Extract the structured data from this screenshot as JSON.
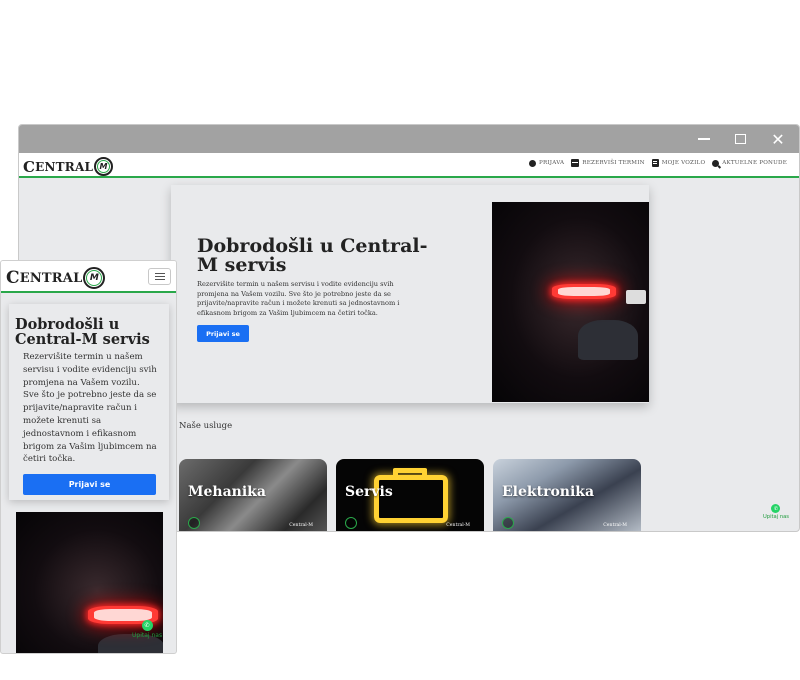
{
  "window": {
    "controls": {
      "minimize": "—",
      "maximize": "□",
      "close": "✕"
    }
  },
  "brand": {
    "logo_first": "C",
    "logo_rest": "ENTRAL",
    "logo_badge": "M"
  },
  "nav": {
    "items": [
      {
        "label": "PRIJAVA",
        "icon": "login-icon"
      },
      {
        "label": "REZERVIŠI TERMIN",
        "icon": "calendar-icon"
      },
      {
        "label": "MOJE VOZILO",
        "icon": "document-icon"
      },
      {
        "label": "AKTUELNE PONUDE",
        "icon": "search-icon"
      }
    ]
  },
  "hero": {
    "title": "Dobrodošli u Central-M servis",
    "description": "Rezervišite termin u našem servisu i vodite evidenciju svih promjena na Vašem vozilu. Sve što je potrebno jeste da se prijavite/napravite račun i možete krenuti sa jednostavnom i efikasnom brigom za Vašim ljubimcem na četiri točka.",
    "button": "Prijavi se"
  },
  "services": {
    "title": "Naše usluge",
    "cards": [
      {
        "title": "Mehanika",
        "brand": "Central-M"
      },
      {
        "title": "Servis",
        "brand": "Central-M"
      },
      {
        "title": "Elektronika",
        "brand": "Central-M"
      }
    ]
  },
  "whatsapp": {
    "label": "Upitaj nas"
  },
  "colors": {
    "accent_green": "#2aa84a",
    "button_blue": "#1a6ff3",
    "whatsapp_green": "#25d366"
  }
}
